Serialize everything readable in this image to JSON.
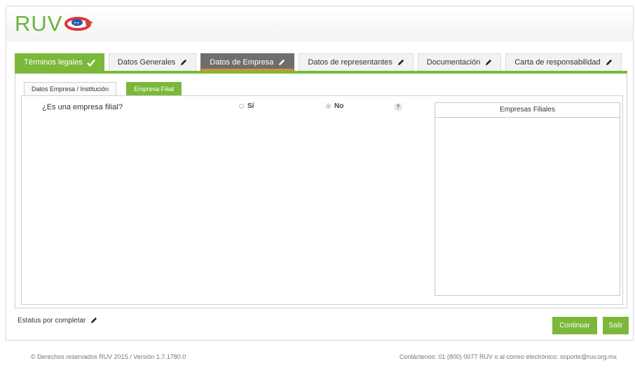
{
  "app": {
    "logo_text": "RUV",
    "brand_green": "#7bb83a",
    "active_tab_gray": "#6e6e6e"
  },
  "tabs": [
    {
      "label": "Términos legales",
      "state": "done",
      "icon": "check-icon"
    },
    {
      "label": "Datos Generales",
      "state": "pending",
      "icon": "pencil-icon"
    },
    {
      "label": "Datos de Empresa",
      "state": "active",
      "icon": "pencil-icon"
    },
    {
      "label": "Datos de representantes",
      "state": "pending",
      "icon": "pencil-icon"
    },
    {
      "label": "Documentación",
      "state": "pending",
      "icon": "pencil-icon"
    },
    {
      "label": "Carta de responsabilidad",
      "state": "pending",
      "icon": "pencil-icon"
    }
  ],
  "subtabs": [
    {
      "label": "Datos Empresa / Institución",
      "active": false
    },
    {
      "label": "Empresa Filial",
      "active": true
    }
  ],
  "form": {
    "question": "¿Es una empresa filial?",
    "option_yes": "Sí",
    "option_no": "No",
    "selected": "No",
    "help": "?"
  },
  "filiales": {
    "header": "Empresas Filiales"
  },
  "status": {
    "label": "Estatus por completar"
  },
  "buttons": {
    "continue": "Continuar",
    "exit": "Salir"
  },
  "footer": {
    "left": "© Derechos reservados RUV 2015 / Versión 1.7.1780.0",
    "right": "Contáctenos: 01 (800) 0077 RUV o al correo electrónico: soporte@ruv.org.mx"
  }
}
